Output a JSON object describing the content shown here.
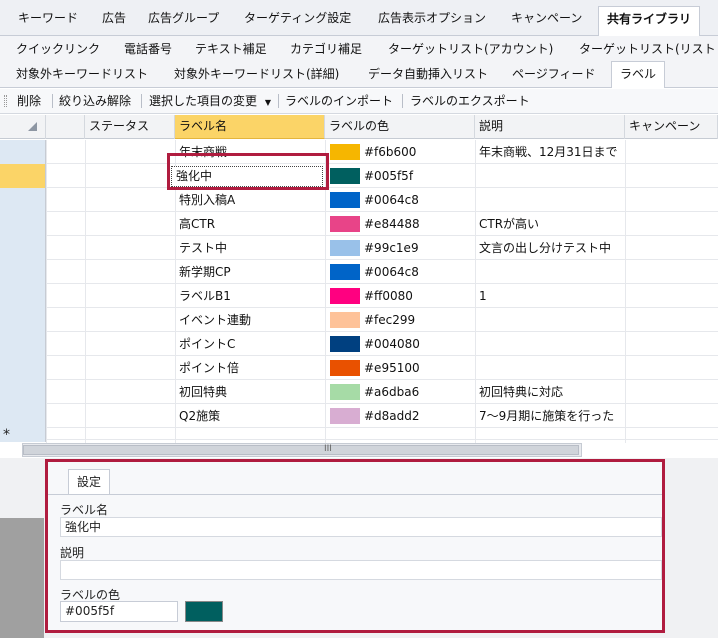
{
  "tabs_row1": [
    {
      "label": "キーワード",
      "active": false
    },
    {
      "label": "広告",
      "active": false
    },
    {
      "label": "広告グループ",
      "active": false
    },
    {
      "label": "ターゲティング設定",
      "active": false
    },
    {
      "label": "広告表示オプション",
      "active": false
    },
    {
      "label": "キャンペーン",
      "active": false
    },
    {
      "label": "共有ライブラリ",
      "active": true
    }
  ],
  "tabs_row2": [
    {
      "label": "クイックリンク"
    },
    {
      "label": "電話番号"
    },
    {
      "label": "テキスト補足"
    },
    {
      "label": "カテゴリ補足"
    },
    {
      "label": "ターゲットリスト(アカウント)"
    },
    {
      "label": "ターゲットリスト(リスト"
    }
  ],
  "tabs_row3": [
    {
      "label": "対象外キーワードリスト",
      "active": false
    },
    {
      "label": "対象外キーワードリスト(詳細)",
      "active": false
    },
    {
      "label": "データ自動挿入リスト",
      "active": false
    },
    {
      "label": "ページフィード",
      "active": false
    },
    {
      "label": "ラベル",
      "active": true
    }
  ],
  "toolbar": {
    "delete": "削除",
    "clear_filter": "絞り込み解除",
    "change_selected": "選択した項目の変更",
    "import": "ラベルのインポート",
    "export": "ラベルのエクスポート"
  },
  "grid": {
    "columns": [
      "ステータス",
      "ラベル名",
      "ラベルの色",
      "説明",
      "キャンペーン"
    ],
    "rows": [
      {
        "name": "年末商戦",
        "color_hex": "#f6b600",
        "description": "年末商戦、12月31日まで"
      },
      {
        "name": "強化中",
        "color_hex": "#005f5f",
        "description": ""
      },
      {
        "name": "特別入稿A",
        "color_hex": "#0064c8",
        "description": ""
      },
      {
        "name": "高CTR",
        "color_hex": "#e84488",
        "description": "CTRが高い"
      },
      {
        "name": "テスト中",
        "color_hex": "#99c1e9",
        "description": "文言の出し分けテスト中"
      },
      {
        "name": "新学期CP",
        "color_hex": "#0064c8",
        "description": ""
      },
      {
        "name": "ラベルB1",
        "color_hex": "#ff0080",
        "description": "1"
      },
      {
        "name": "イベント連動",
        "color_hex": "#fec299",
        "description": ""
      },
      {
        "name": "ポイントC",
        "color_hex": "#004080",
        "description": ""
      },
      {
        "name": "ポイント倍",
        "color_hex": "#e95100",
        "description": ""
      },
      {
        "name": "初回特典",
        "color_hex": "#a6dba6",
        "description": "初回特典に対応"
      },
      {
        "name": "Q2施策",
        "color_hex": "#d8add2",
        "description": "7～9月期に施策を行った"
      }
    ],
    "new_row_marker": "*",
    "scroll_grip": "III"
  },
  "detail": {
    "tab": "設定",
    "name_label": "ラベル名",
    "name_value": "強化中",
    "desc_label": "説明",
    "desc_value": "",
    "color_label": "ラベルの色",
    "color_value": "#005f5f"
  },
  "colors": {
    "accent_red": "#b01c3f",
    "selected_header": "#fbd467"
  }
}
